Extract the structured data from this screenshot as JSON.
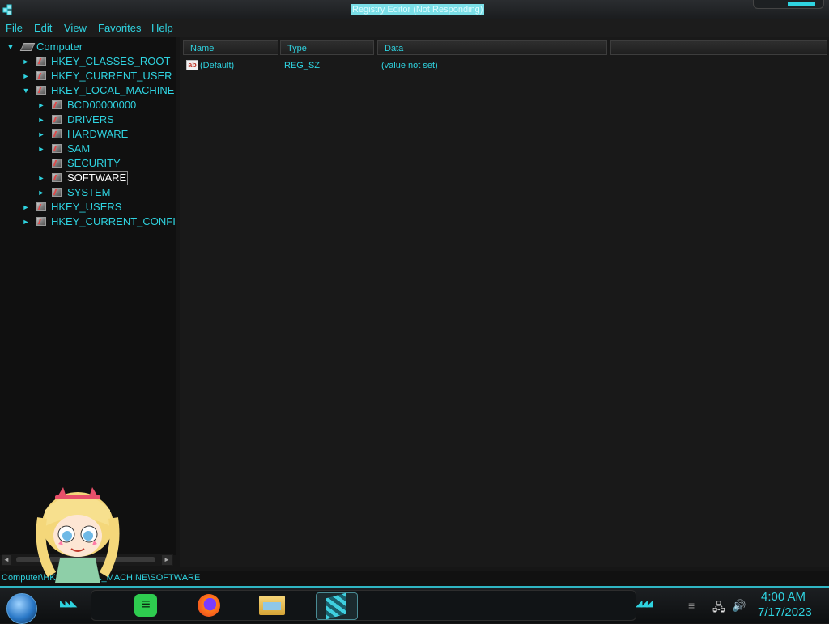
{
  "window": {
    "title": "Registry Editor (Not Responding)"
  },
  "menu": {
    "items": [
      "File",
      "Edit",
      "View",
      "Favorites",
      "Help"
    ]
  },
  "tree": {
    "root": "Computer",
    "hives": {
      "classes_root": "HKEY_CLASSES_ROOT",
      "current_user": "HKEY_CURRENT_USER",
      "local_machine": "HKEY_LOCAL_MACHINE",
      "users": "HKEY_USERS",
      "current_config": "HKEY_CURRENT_CONFI"
    },
    "local_machine_children": [
      "BCD00000000",
      "DRIVERS",
      "HARDWARE",
      "SAM",
      "SECURITY",
      "SOFTWARE",
      "SYSTEM"
    ],
    "selected": "SOFTWARE"
  },
  "list": {
    "columns": [
      "Name",
      "Type",
      "Data"
    ],
    "rows": [
      {
        "name": "(Default)",
        "type": "REG_SZ",
        "data": "(value not set)",
        "icon": "string-value-icon"
      }
    ]
  },
  "status": {
    "path": "Computer\\HKEY_LOCAL_MACHINE\\SOFTWARE"
  },
  "taskbar": {
    "apps": [
      "spotify-icon",
      "firefox-icon",
      "file-explorer-icon",
      "registry-editor-icon"
    ],
    "time": "4:00 AM",
    "date": "7/17/2023"
  },
  "colors": {
    "accent": "#2fd3e0",
    "background": "#161616"
  }
}
